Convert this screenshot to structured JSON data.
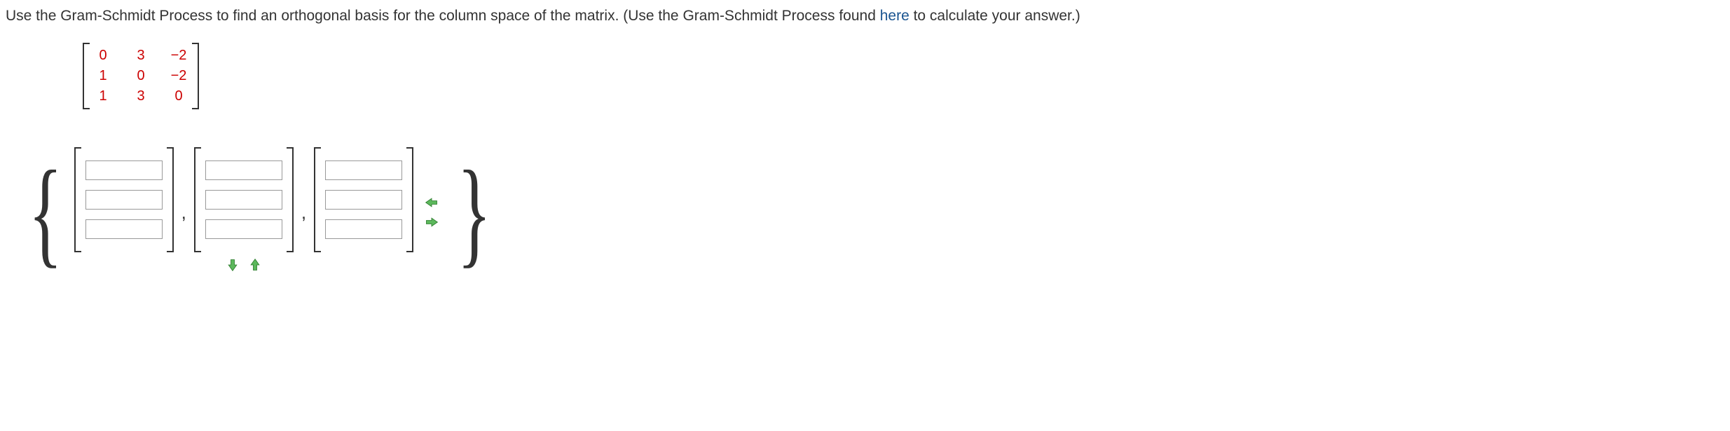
{
  "question": {
    "text_before_link": "Use the Gram-Schmidt Process to find an orthogonal basis for the column space of the matrix. (Use the Gram-Schmidt Process found ",
    "link_text": "here",
    "text_after_link": " to calculate your answer.)"
  },
  "matrix": {
    "rows": [
      [
        "0",
        "3",
        "−2"
      ],
      [
        "1",
        "0",
        "−2"
      ],
      [
        "1",
        "3",
        "0"
      ]
    ]
  },
  "answer": {
    "vector_count": 3,
    "rows_per_vector": 3
  },
  "arrows": {
    "left": "←",
    "right": "→",
    "down": "↓",
    "up": "↑"
  }
}
